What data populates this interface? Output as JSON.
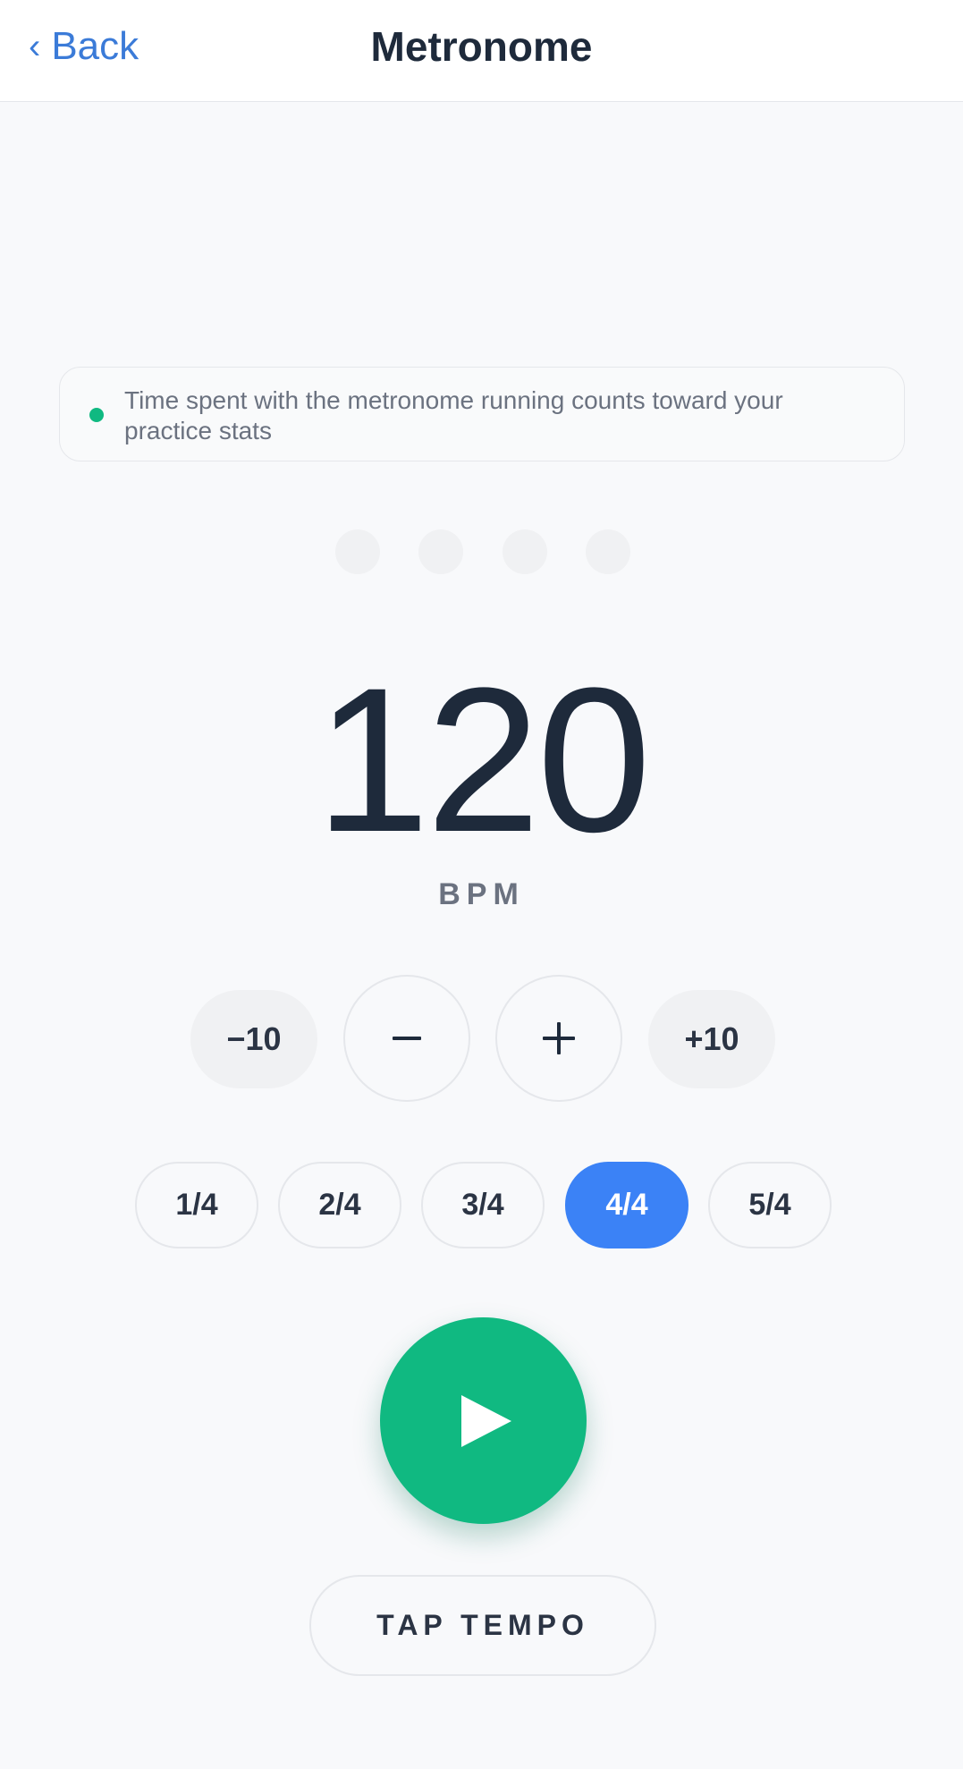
{
  "header": {
    "back_label": "Back",
    "title": "Metronome"
  },
  "notice": {
    "text": "Time spent with the metronome running counts toward your practice stats",
    "dot_color": "#10b981"
  },
  "beats": {
    "count": 4,
    "active_index": null
  },
  "tempo": {
    "value": "120",
    "unit": "BPM"
  },
  "steppers": {
    "minus_ten": "−10",
    "minus_icon": "minus-icon",
    "plus_icon": "plus-icon",
    "plus_ten": "+10"
  },
  "time_signatures": {
    "options": [
      "1/4",
      "2/4",
      "3/4",
      "4/4",
      "5/4"
    ],
    "selected": "4/4"
  },
  "controls": {
    "play_icon": "play-icon",
    "tap_tempo_label": "TAP TEMPO"
  },
  "colors": {
    "accent_green": "#10b981",
    "accent_blue": "#3b82f6",
    "link_blue": "#3b7bd8",
    "text_dark": "#1e2a3b"
  }
}
